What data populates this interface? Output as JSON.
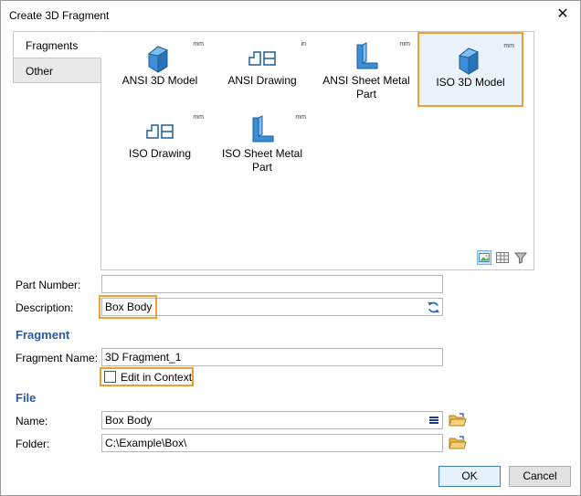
{
  "window": {
    "title": "Create 3D Fragment",
    "close_glyph": "✕"
  },
  "tabs": [
    {
      "label": "Fragments",
      "active": true
    },
    {
      "label": "Other",
      "active": false
    }
  ],
  "gallery": {
    "tiles": [
      {
        "label": "ANSI 3D Model",
        "unit": "mm",
        "icon": "3d-model-icon",
        "selected": false
      },
      {
        "label": "ANSI Drawing",
        "unit": "in",
        "icon": "drawing-icon",
        "selected": false
      },
      {
        "label": "ANSI Sheet Metal Part",
        "unit": "mm",
        "icon": "sheet-metal-icon",
        "selected": false
      },
      {
        "label": "ISO 3D Model",
        "unit": "mm",
        "icon": "3d-model-icon",
        "selected": true
      },
      {
        "label": "ISO Drawing",
        "unit": "mm",
        "icon": "drawing-icon",
        "selected": false
      },
      {
        "label": "ISO Sheet Metal Part",
        "unit": "mm",
        "icon": "sheet-metal-icon",
        "selected": false
      }
    ],
    "view_icons": [
      "thumbnail-view-icon",
      "grid-view-icon",
      "filter-icon"
    ]
  },
  "form": {
    "part_number": {
      "label": "Part Number:",
      "value": ""
    },
    "description": {
      "label": "Description:",
      "value": "Box Body"
    },
    "fragment_section": "Fragment",
    "fragment_name": {
      "label": "Fragment Name:",
      "value": "3D Fragment_1"
    },
    "edit_in_context": {
      "label": "Edit in Context",
      "checked": false
    },
    "file_section": "File",
    "name": {
      "label": "Name:",
      "value": "Box Body"
    },
    "folder": {
      "label": "Folder:",
      "value": "C:\\Example\\Box\\"
    }
  },
  "buttons": {
    "ok": "OK",
    "cancel": "Cancel"
  },
  "colors": {
    "accent": "#2b5aa0",
    "highlight": "#f0a030",
    "icon_blue": "#3a8fd8"
  }
}
